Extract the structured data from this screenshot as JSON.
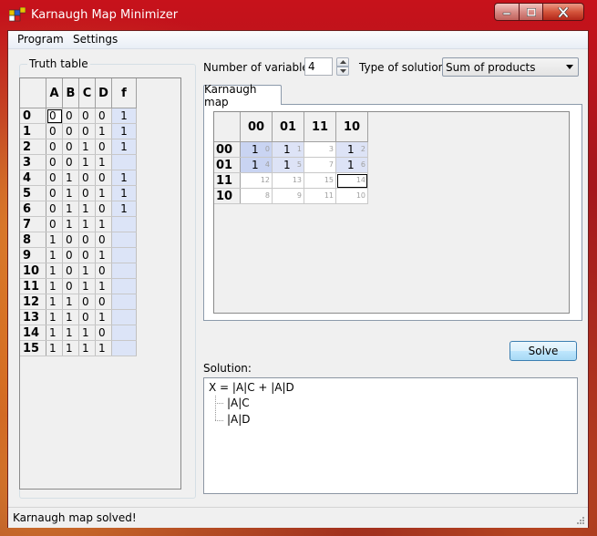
{
  "window": {
    "title": "Karnaugh Map Minimizer"
  },
  "menu": {
    "program": "Program",
    "settings": "Settings"
  },
  "truth_table": {
    "group_title": "Truth table",
    "headers": [
      "A",
      "B",
      "C",
      "D",
      "f"
    ],
    "rows": [
      {
        "index": "0",
        "bits": [
          "0",
          "0",
          "0",
          "0"
        ],
        "f": "1"
      },
      {
        "index": "1",
        "bits": [
          "0",
          "0",
          "0",
          "1"
        ],
        "f": "1"
      },
      {
        "index": "2",
        "bits": [
          "0",
          "0",
          "1",
          "0"
        ],
        "f": "1"
      },
      {
        "index": "3",
        "bits": [
          "0",
          "0",
          "1",
          "1"
        ],
        "f": ""
      },
      {
        "index": "4",
        "bits": [
          "0",
          "1",
          "0",
          "0"
        ],
        "f": "1"
      },
      {
        "index": "5",
        "bits": [
          "0",
          "1",
          "0",
          "1"
        ],
        "f": "1"
      },
      {
        "index": "6",
        "bits": [
          "0",
          "1",
          "1",
          "0"
        ],
        "f": "1"
      },
      {
        "index": "7",
        "bits": [
          "0",
          "1",
          "1",
          "1"
        ],
        "f": ""
      },
      {
        "index": "8",
        "bits": [
          "1",
          "0",
          "0",
          "0"
        ],
        "f": ""
      },
      {
        "index": "9",
        "bits": [
          "1",
          "0",
          "0",
          "1"
        ],
        "f": ""
      },
      {
        "index": "10",
        "bits": [
          "1",
          "0",
          "1",
          "0"
        ],
        "f": ""
      },
      {
        "index": "11",
        "bits": [
          "1",
          "0",
          "1",
          "1"
        ],
        "f": ""
      },
      {
        "index": "12",
        "bits": [
          "1",
          "1",
          "0",
          "0"
        ],
        "f": ""
      },
      {
        "index": "13",
        "bits": [
          "1",
          "1",
          "0",
          "1"
        ],
        "f": ""
      },
      {
        "index": "14",
        "bits": [
          "1",
          "1",
          "1",
          "0"
        ],
        "f": ""
      },
      {
        "index": "15",
        "bits": [
          "1",
          "1",
          "1",
          "1"
        ],
        "f": ""
      }
    ]
  },
  "controls": {
    "num_vars_label": "Number of variables:",
    "num_vars_value": "4",
    "solution_type_label": "Type of solution:",
    "solution_type_value": "Sum of products"
  },
  "kmap": {
    "tab_label": "Karnaugh map",
    "col_headers": [
      "00",
      "01",
      "11",
      "10"
    ],
    "rows": [
      {
        "header": "00",
        "cells": [
          {
            "value": "1",
            "index": "0",
            "style": "grp"
          },
          {
            "value": "1",
            "index": "1",
            "style": "grp2"
          },
          {
            "value": "",
            "index": "3",
            "style": ""
          },
          {
            "value": "1",
            "index": "2",
            "style": "grp2"
          }
        ]
      },
      {
        "header": "01",
        "cells": [
          {
            "value": "1",
            "index": "4",
            "style": "grp"
          },
          {
            "value": "1",
            "index": "5",
            "style": "grp2"
          },
          {
            "value": "",
            "index": "7",
            "style": ""
          },
          {
            "value": "1",
            "index": "6",
            "style": "grp2"
          }
        ]
      },
      {
        "header": "11",
        "cells": [
          {
            "value": "",
            "index": "12",
            "style": ""
          },
          {
            "value": "",
            "index": "13",
            "style": ""
          },
          {
            "value": "",
            "index": "15",
            "style": ""
          },
          {
            "value": "",
            "index": "14",
            "style": "sel"
          }
        ]
      },
      {
        "header": "10",
        "cells": [
          {
            "value": "",
            "index": "8",
            "style": ""
          },
          {
            "value": "",
            "index": "9",
            "style": ""
          },
          {
            "value": "",
            "index": "11",
            "style": ""
          },
          {
            "value": "",
            "index": "10",
            "style": ""
          }
        ]
      }
    ]
  },
  "solve_button": "Solve",
  "solution": {
    "label": "Solution:",
    "expression": "X = |A|C + |A|D",
    "terms": [
      "|A|C",
      "|A|D"
    ]
  },
  "status": {
    "text": "Karnaugh map solved!"
  },
  "colors": {
    "title_bar": "#b3151c",
    "truth_f_column": "#dce4f7",
    "kmap_group": "#c9d4f2"
  }
}
